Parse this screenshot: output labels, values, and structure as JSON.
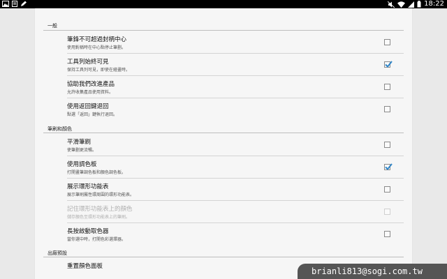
{
  "status_bar": {
    "time": "18:22",
    "left_icons": [
      "image-icon",
      "document-icon",
      "pen-icon"
    ],
    "right_icons": [
      "mute-icon",
      "wifi-icon",
      "signal-icon",
      "battery-icon"
    ]
  },
  "sections": [
    {
      "header": "一般",
      "items": [
        {
          "title": "筆鋒不可超過封柄中心",
          "summary": "使用對稱時在中心點停止筆劃。",
          "checked": false,
          "enabled": true
        },
        {
          "title": "工具列始終可見",
          "summary": "保持工具列可見，即使在繪畫時。",
          "checked": true,
          "enabled": true
        },
        {
          "title": "協助我們改進產品",
          "summary": "允許收集產品使用資料。",
          "checked": false,
          "enabled": true
        },
        {
          "title": "使用返回鍵退回",
          "summary": "點選「返回」鍵執行退回。",
          "checked": false,
          "enabled": true
        }
      ]
    },
    {
      "header": "筆刷和顏色",
      "items": [
        {
          "title": "平滑筆刷",
          "summary": "使筆劃更流暢。",
          "checked": false,
          "enabled": true
        },
        {
          "title": "使用調色板",
          "summary": "打開畫筆調色板和顏色調色板。",
          "checked": true,
          "enabled": true
        },
        {
          "title": "展示環形功能表",
          "summary": "展示筆刷屬性環周圍的環形功能表。",
          "checked": false,
          "enabled": true
        },
        {
          "title": "記住環形功能表上的顏色",
          "summary": "儲存顏色至環形功能表上的筆刷。",
          "checked": false,
          "enabled": false
        },
        {
          "title": "長按啟動取色器",
          "summary": "當你選中時，打開色彩選擇器。",
          "checked": false,
          "enabled": true
        }
      ]
    },
    {
      "header": "出廠預設",
      "items": [
        {
          "title": "重置顏色面板",
          "summary": "",
          "checked": false,
          "enabled": true
        }
      ]
    }
  ],
  "watermark": "brianli813@sogi.com.tw",
  "colors": {
    "check": "#2f86c9",
    "statusbar": "#000000",
    "panel": "#f6f6f6",
    "background": "#e9e9e9"
  }
}
